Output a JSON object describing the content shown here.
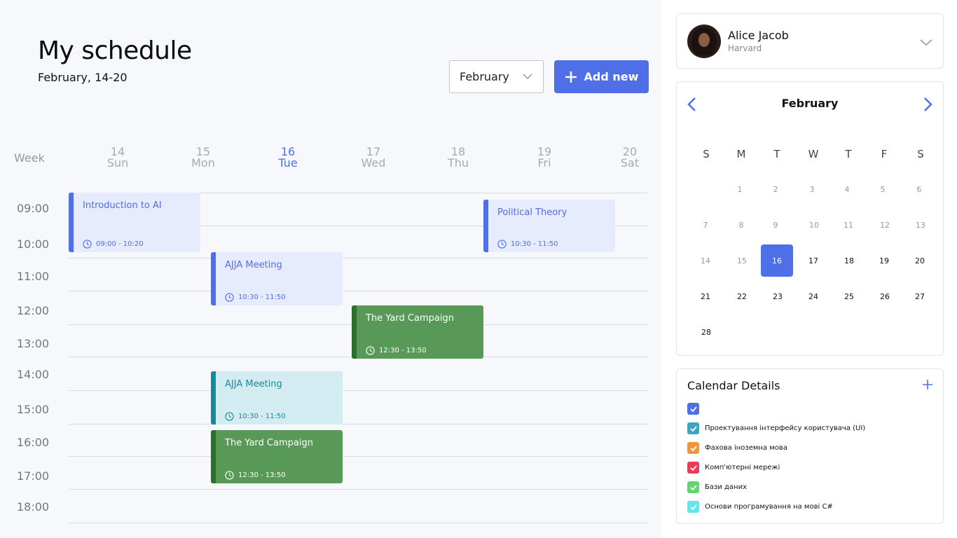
{
  "header": {
    "title": "My schedule",
    "subtitle": "February, 14-20",
    "month_select_value": "February",
    "add_button_label": "Add new"
  },
  "week": {
    "label": "Week",
    "days": [
      {
        "num": "14",
        "name": "Sun"
      },
      {
        "num": "15",
        "name": "Mon"
      },
      {
        "num": "16",
        "name": "Tue"
      },
      {
        "num": "17",
        "name": "Wed"
      },
      {
        "num": "18",
        "name": "Thu"
      },
      {
        "num": "19",
        "name": "Fri"
      },
      {
        "num": "20",
        "name": "Sat"
      }
    ],
    "active_day_index": 2
  },
  "times": [
    "09:00",
    "10:00",
    "11:00",
    "12:00",
    "13:00",
    "14:00",
    "15:00",
    "16:00",
    "17:00",
    "18:00"
  ],
  "events": [
    {
      "title": "Introduction to AI",
      "time": "09:00 - 10:20",
      "color": "blue"
    },
    {
      "title": "Political Theory",
      "time": "10:30 - 11:50",
      "color": "blue"
    },
    {
      "title": "AJJA Meeting",
      "time": "10:30 - 11:50",
      "color": "blue"
    },
    {
      "title": "The Yard Campaign",
      "time": "12:30 - 13:50",
      "color": "green"
    },
    {
      "title": "AJJA Meeting",
      "time": "10:30 - 11:50",
      "color": "teal"
    },
    {
      "title": "The Yard Campaign",
      "time": "12:30 - 13:50",
      "color": "green"
    }
  ],
  "profile": {
    "name": "Alice Jacob",
    "org": "Harvard"
  },
  "mini_calendar": {
    "month": "February",
    "weekdays": [
      "S",
      "M",
      "T",
      "W",
      "T",
      "F",
      "S"
    ],
    "rows": [
      [
        "",
        "1",
        "2",
        "3",
        "4",
        "5",
        "6"
      ],
      [
        "7",
        "8",
        "9",
        "10",
        "11",
        "12",
        "13"
      ],
      [
        "14",
        "15",
        "16",
        "17",
        "18",
        "19",
        "20"
      ],
      [
        "21",
        "22",
        "23",
        "24",
        "25",
        "26",
        "27"
      ],
      [
        "28",
        "",
        "",
        "",
        "",
        "",
        ""
      ]
    ],
    "selected": "16"
  },
  "calendar_details": {
    "title": "Calendar Details",
    "items": [
      {
        "label": "",
        "color": "#4f6fe8"
      },
      {
        "label": "Проектування інтерфейсу користувача (UI)",
        "color": "#3aa6c4"
      },
      {
        "label": "Фахова іноземна мова",
        "color": "#f0963c"
      },
      {
        "label": "Комп'ютерні мережі",
        "color": "#ee3b55"
      },
      {
        "label": "Бази даних",
        "color": "#5fd672"
      },
      {
        "label": "Основи програмування на мові C#",
        "color": "#5ee6f0"
      }
    ]
  },
  "colors": {
    "accent": "#4f6fe8",
    "event_green": "#589958",
    "event_teal": "#168a9a"
  }
}
